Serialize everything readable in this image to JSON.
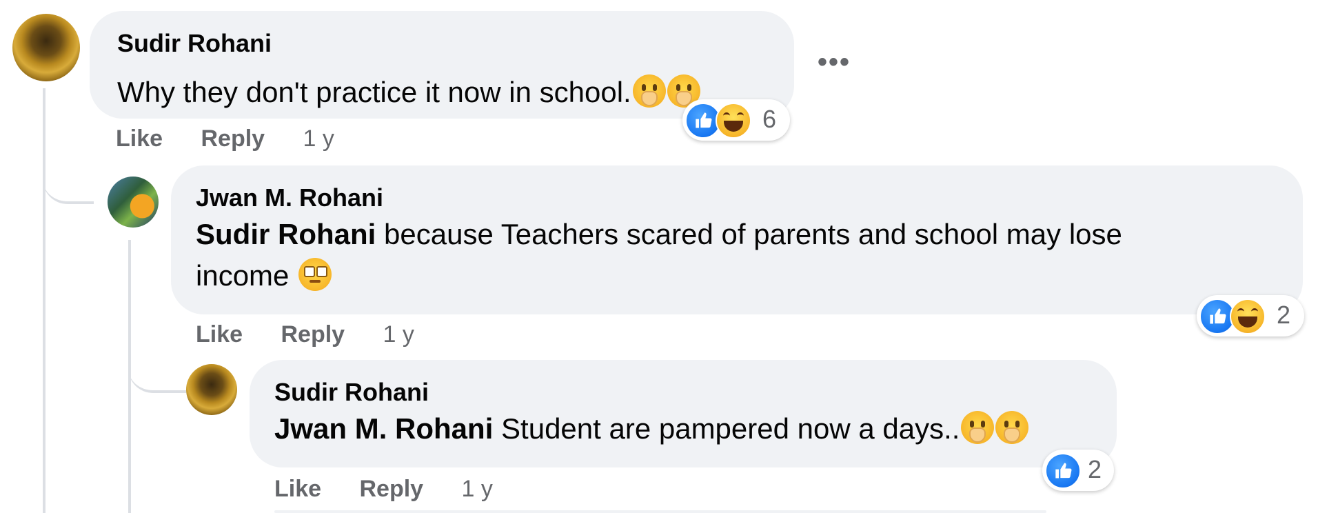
{
  "comments": [
    {
      "author": "Sudir Rohani",
      "text": "Why they don't practice it now in school.",
      "emojis": [
        "hand-over-mouth-emoji",
        "hand-over-mouth-emoji"
      ],
      "actions": {
        "like": "Like",
        "reply": "Reply",
        "time": "1 y"
      },
      "reactions": {
        "icons": [
          "like-reaction",
          "haha-reaction"
        ],
        "count": "6"
      },
      "more_label": "•••"
    },
    {
      "author": "Jwan M. Rohani",
      "mention": "Sudir Rohani",
      "text_line1": " because Teachers scared of parents and school may lose",
      "text_line2": "income ",
      "emojis": [
        "eye-roll-emoji"
      ],
      "actions": {
        "like": "Like",
        "reply": "Reply",
        "time": "1 y"
      },
      "reactions": {
        "icons": [
          "like-reaction",
          "haha-reaction"
        ],
        "count": "2"
      }
    },
    {
      "author": "Sudir Rohani",
      "mention": "Jwan M. Rohani",
      "text": " Student are pampered now a days..",
      "emojis": [
        "hand-over-mouth-emoji",
        "hand-over-mouth-emoji"
      ],
      "actions": {
        "like": "Like",
        "reply": "Reply",
        "time": "1 y"
      },
      "reactions": {
        "icons": [
          "like-reaction"
        ],
        "count": "2"
      }
    }
  ],
  "colors": {
    "bubble": "#f0f2f5",
    "muted_text": "#65676b",
    "like_blue": "#1877f2",
    "thread_line": "#dcdfe4"
  }
}
